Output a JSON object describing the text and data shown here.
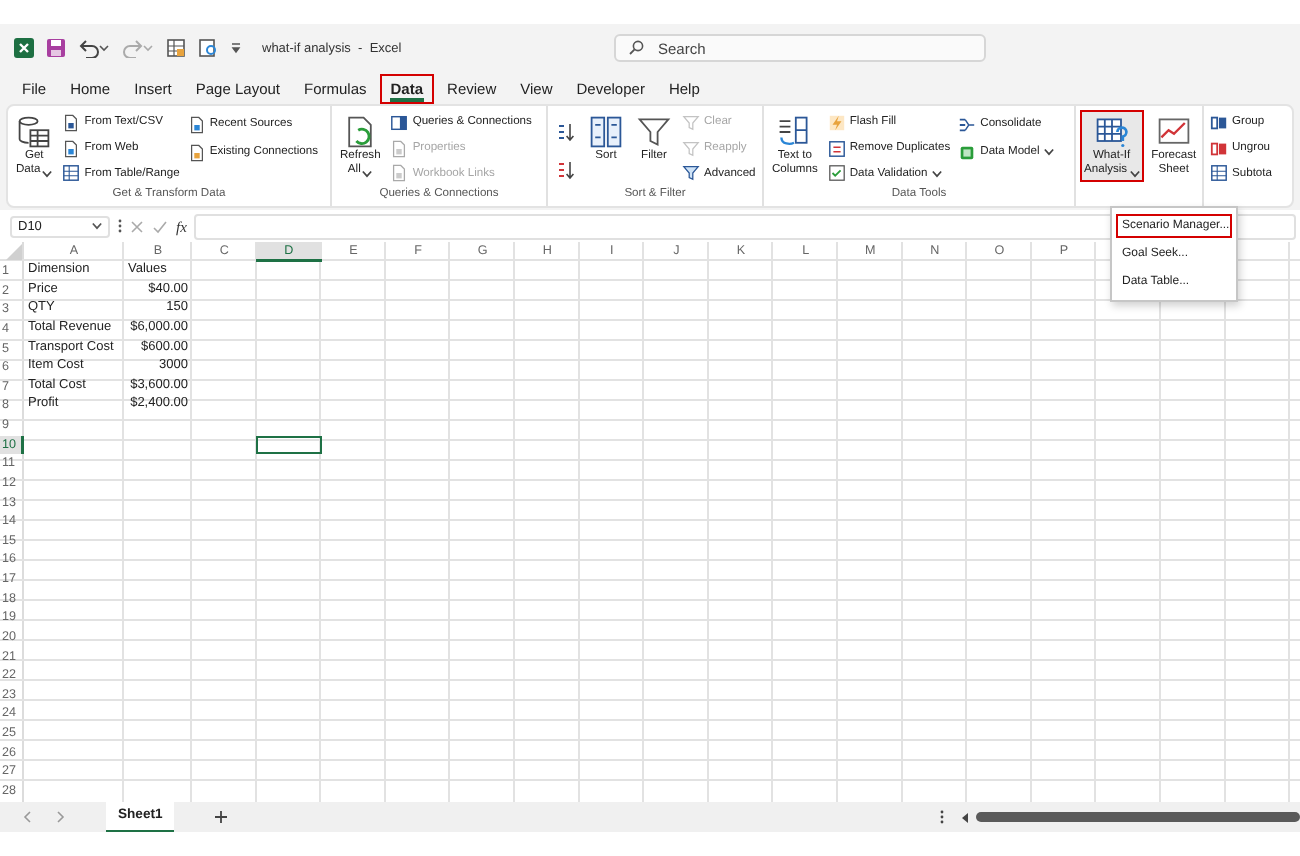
{
  "title_bar": {
    "title": "what-if analysis  -  Excel",
    "search": {
      "placeholder": "Search"
    }
  },
  "menu_tabs": [
    {
      "label": "File",
      "selected": false,
      "highlighted": false
    },
    {
      "label": "Home",
      "selected": false,
      "highlighted": false
    },
    {
      "label": "Insert",
      "selected": false,
      "highlighted": false
    },
    {
      "label": "Page Layout",
      "selected": false,
      "highlighted": false
    },
    {
      "label": "Formulas",
      "selected": false,
      "highlighted": false
    },
    {
      "label": "Data",
      "selected": true,
      "highlighted": true
    },
    {
      "label": "Review",
      "selected": false,
      "highlighted": false
    },
    {
      "label": "View",
      "selected": false,
      "highlighted": false
    },
    {
      "label": "Developer",
      "selected": false,
      "highlighted": false
    },
    {
      "label": "Help",
      "selected": false,
      "highlighted": false
    }
  ],
  "ribbon_groups": [
    {
      "label": "Get & Transform Data",
      "columns": [
        [
          {
            "kind": "large",
            "label": "Get\nData",
            "dropdown": true,
            "disabled": false,
            "highlighted": false
          }
        ],
        [
          {
            "kind": "small",
            "label": "From Text/CSV",
            "dropdown": false,
            "disabled": false,
            "highlighted": false
          },
          {
            "kind": "small",
            "label": "From Web",
            "dropdown": false,
            "disabled": false,
            "highlighted": false
          },
          {
            "kind": "small",
            "label": "From Table/Range",
            "dropdown": false,
            "disabled": false,
            "highlighted": false
          }
        ],
        [
          {
            "kind": "small",
            "label": "Recent Sources",
            "dropdown": false,
            "disabled": false,
            "highlighted": false
          },
          {
            "kind": "small",
            "label": "Existing Connections",
            "dropdown": false,
            "disabled": false,
            "highlighted": false
          }
        ]
      ]
    },
    {
      "label": "Queries & Connections",
      "columns": [
        [
          {
            "kind": "large",
            "label": "Refresh\nAll",
            "dropdown": true,
            "disabled": false,
            "highlighted": false
          }
        ],
        [
          {
            "kind": "small",
            "label": "Queries & Connections",
            "dropdown": false,
            "disabled": false,
            "highlighted": false
          },
          {
            "kind": "small",
            "label": "Properties",
            "dropdown": false,
            "disabled": true,
            "highlighted": false
          },
          {
            "kind": "small",
            "label": "Workbook Links",
            "dropdown": false,
            "disabled": true,
            "highlighted": false
          }
        ]
      ]
    },
    {
      "label": "Sort & Filter",
      "columns": [
        [
          {
            "kind": "icon",
            "disabled": false,
            "highlighted": false
          },
          {
            "kind": "icon",
            "disabled": false,
            "highlighted": false
          }
        ],
        [
          {
            "kind": "large",
            "label": "Sort",
            "dropdown": false,
            "disabled": false,
            "highlighted": false
          }
        ],
        [
          {
            "kind": "large",
            "label": "Filter",
            "dropdown": false,
            "disabled": false,
            "highlighted": false
          }
        ],
        [
          {
            "kind": "small",
            "label": "Clear",
            "dropdown": false,
            "disabled": true,
            "highlighted": false
          },
          {
            "kind": "small",
            "label": "Reapply",
            "dropdown": false,
            "disabled": true,
            "highlighted": false
          },
          {
            "kind": "small",
            "label": "Advanced",
            "dropdown": false,
            "disabled": false,
            "highlighted": false
          }
        ]
      ]
    },
    {
      "label": "Data Tools",
      "columns": [
        [
          {
            "kind": "large",
            "label": "Text to\nColumns",
            "dropdown": false,
            "disabled": false,
            "highlighted": false
          }
        ],
        [
          {
            "kind": "small",
            "label": "Flash Fill",
            "dropdown": false,
            "disabled": false,
            "highlighted": false
          },
          {
            "kind": "small",
            "label": "Remove Duplicates",
            "dropdown": false,
            "disabled": false,
            "highlighted": false
          },
          {
            "kind": "small",
            "label": "Data Validation",
            "dropdown": true,
            "disabled": false,
            "highlighted": false
          }
        ],
        [
          {
            "kind": "small",
            "label": "Consolidate",
            "dropdown": false,
            "disabled": false,
            "highlighted": false
          },
          {
            "kind": "small",
            "label": "Data Model",
            "dropdown": true,
            "disabled": false,
            "highlighted": false
          }
        ]
      ]
    },
    {
      "columns": [
        [
          {
            "kind": "large",
            "label": "What-If\nAnalysis",
            "dropdown": true,
            "disabled": false,
            "highlighted": true
          }
        ],
        [
          {
            "kind": "large",
            "label": "Forecast\nSheet",
            "dropdown": false,
            "disabled": false,
            "highlighted": false
          }
        ]
      ]
    },
    {
      "columns": [
        [
          {
            "kind": "small",
            "label": "Group",
            "dropdown": false,
            "disabled": false,
            "highlighted": false
          },
          {
            "kind": "small",
            "label": "Ungrou",
            "dropdown": false,
            "disabled": false,
            "highlighted": false
          },
          {
            "kind": "small",
            "label": "Subtota",
            "dropdown": false,
            "disabled": false,
            "highlighted": false
          }
        ]
      ]
    }
  ],
  "formula_bar": {
    "name_box": "D10",
    "function_label": "fx"
  },
  "sheet": {
    "columns": [
      {
        "label": "A",
        "selected": false
      },
      {
        "label": "B",
        "selected": false
      },
      {
        "label": "C",
        "selected": false
      },
      {
        "label": "D",
        "selected": true
      },
      {
        "label": "E",
        "selected": false
      },
      {
        "label": "F",
        "selected": false
      },
      {
        "label": "G",
        "selected": false
      },
      {
        "label": "H",
        "selected": false
      },
      {
        "label": "I",
        "selected": false
      },
      {
        "label": "J",
        "selected": false
      },
      {
        "label": "K",
        "selected": false
      },
      {
        "label": "L",
        "selected": false
      },
      {
        "label": "M",
        "selected": false
      },
      {
        "label": "N",
        "selected": false
      },
      {
        "label": "O",
        "selected": false
      },
      {
        "label": "P",
        "selected": false
      }
    ],
    "rows": [
      {
        "label": "1",
        "selected": false,
        "cells": [
          {
            "text": "Dimension",
            "kind": "text"
          },
          {
            "text": "Values",
            "kind": "text"
          }
        ]
      },
      {
        "label": "2",
        "selected": false,
        "cells": [
          {
            "text": "Price",
            "kind": "text"
          },
          {
            "text": "$40.00",
            "kind": "number"
          }
        ]
      },
      {
        "label": "3",
        "selected": false,
        "cells": [
          {
            "text": "QTY",
            "kind": "text"
          },
          {
            "text": "150",
            "kind": "number"
          }
        ]
      },
      {
        "label": "4",
        "selected": false,
        "cells": [
          {
            "text": "Total Revenue",
            "kind": "text"
          },
          {
            "text": "$6,000.00",
            "kind": "number"
          }
        ]
      },
      {
        "label": "5",
        "selected": false,
        "cells": [
          {
            "text": "Transport Cost",
            "kind": "text"
          },
          {
            "text": "$600.00",
            "kind": "number"
          }
        ]
      },
      {
        "label": "6",
        "selected": false,
        "cells": [
          {
            "text": "Item Cost",
            "kind": "text"
          },
          {
            "text": "3000",
            "kind": "number"
          }
        ]
      },
      {
        "label": "7",
        "selected": false,
        "cells": [
          {
            "text": "Total Cost",
            "kind": "text"
          },
          {
            "text": "$3,600.00",
            "kind": "number"
          }
        ]
      },
      {
        "label": "8",
        "selected": false,
        "cells": [
          {
            "text": "Profit",
            "kind": "text"
          },
          {
            "text": "$2,400.00",
            "kind": "number"
          }
        ]
      },
      {
        "label": "9",
        "selected": false
      },
      {
        "label": "10",
        "selected": true
      },
      {
        "label": "11",
        "selected": false
      },
      {
        "label": "12",
        "selected": false
      },
      {
        "label": "13",
        "selected": false
      },
      {
        "label": "14",
        "selected": false
      },
      {
        "label": "15",
        "selected": false
      },
      {
        "label": "16",
        "selected": false
      },
      {
        "label": "17",
        "selected": false
      },
      {
        "label": "18",
        "selected": false
      },
      {
        "label": "19",
        "selected": false
      },
      {
        "label": "20",
        "selected": false
      },
      {
        "label": "21",
        "selected": false
      },
      {
        "label": "22",
        "selected": false
      },
      {
        "label": "23",
        "selected": false
      },
      {
        "label": "24",
        "selected": false
      },
      {
        "label": "25",
        "selected": false
      },
      {
        "label": "26",
        "selected": false
      },
      {
        "label": "27",
        "selected": false
      },
      {
        "label": "28",
        "selected": false
      }
    ]
  },
  "sheet_tabs": [
    {
      "label": "Sheet1",
      "selected": true
    }
  ],
  "dropdown_menu": {
    "items": [
      {
        "label": "Scenario Manager...",
        "highlighted": true
      },
      {
        "label": "Goal Seek...",
        "highlighted": false
      },
      {
        "label": "Data Table...",
        "highlighted": false
      }
    ]
  }
}
